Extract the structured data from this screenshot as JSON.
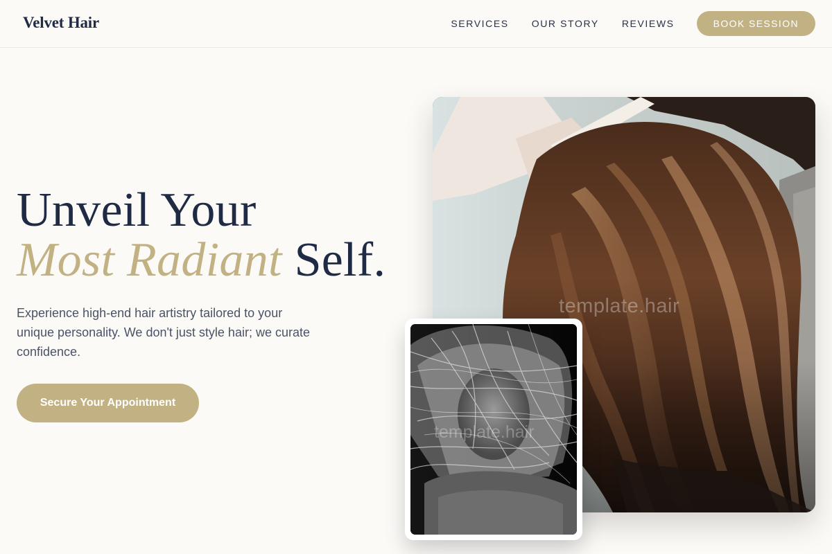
{
  "header": {
    "logo": "Velvet Hair",
    "nav": [
      {
        "label": "SERVICES"
      },
      {
        "label": "OUR STORY"
      },
      {
        "label": "REVIEWS"
      }
    ],
    "book_label": "BOOK SESSION"
  },
  "hero": {
    "headline_line1": "Unveil Your",
    "headline_accent": "Most Radiant",
    "headline_end": "Self.",
    "description": "Experience high-end hair artistry tailored to your unique personality. We don't just style hair; we curate confidence.",
    "cta_label": "Secure Your Appointment"
  },
  "images": {
    "main_watermark": "template.hair",
    "inset_watermark": "template.hair"
  },
  "colors": {
    "accent": "#c2b283",
    "text_dark": "#1f2a44",
    "background": "#fbfaf7"
  }
}
